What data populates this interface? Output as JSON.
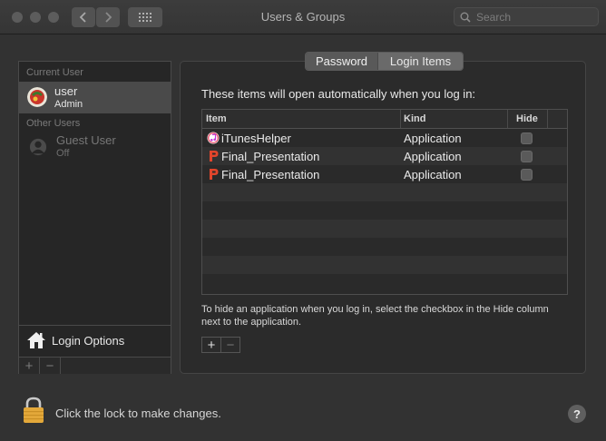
{
  "window": {
    "title": "Users & Groups"
  },
  "search": {
    "placeholder": "Search"
  },
  "sidebar": {
    "current_user_label": "Current User",
    "current_user": {
      "name": "user",
      "role": "Admin"
    },
    "other_users_label": "Other Users",
    "other_users": [
      {
        "name": "Guest User",
        "status": "Off"
      }
    ],
    "login_options_label": "Login Options",
    "add_symbol": "+",
    "remove_symbol": "−"
  },
  "tabs": [
    {
      "label": "Password",
      "selected": false
    },
    {
      "label": "Login Items",
      "selected": true
    }
  ],
  "login_items": {
    "heading": "These items will open automatically when you log in:",
    "columns": {
      "item": "Item",
      "kind": "Kind",
      "hide": "Hide"
    },
    "rows": [
      {
        "name": "iTunesHelper",
        "kind": "Application",
        "hide": false,
        "icon": "itunes-icon"
      },
      {
        "name": "Final_Presentation",
        "kind": "Application",
        "hide": false,
        "icon": "keynote-icon"
      },
      {
        "name": "Final_Presentation",
        "kind": "Application",
        "hide": false,
        "icon": "keynote-icon"
      }
    ],
    "note": "To hide an application when you log in, select the checkbox in the Hide column next to the application.",
    "add_symbol": "+",
    "remove_symbol": "−"
  },
  "footer": {
    "lock_text": "Click the lock to make changes.",
    "help_symbol": "?"
  }
}
